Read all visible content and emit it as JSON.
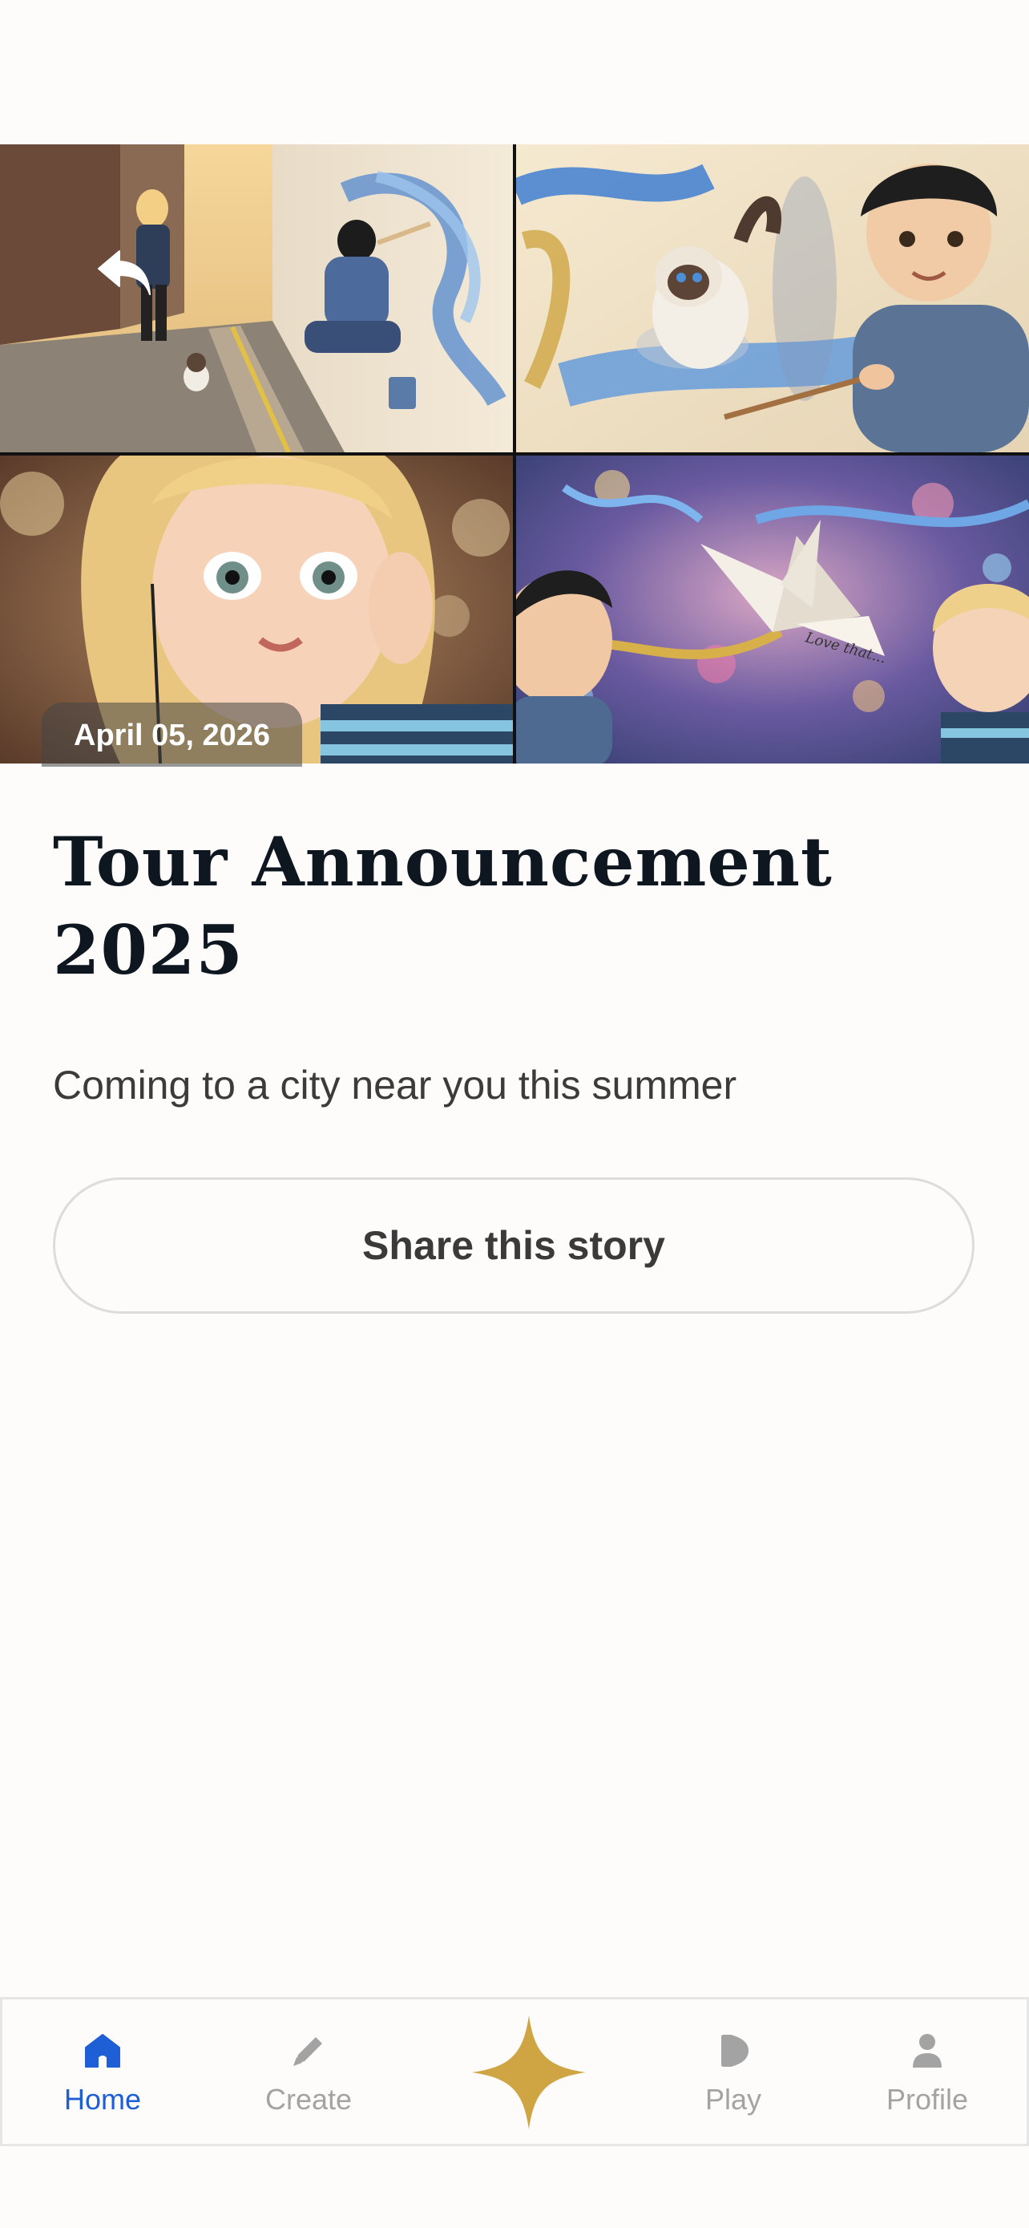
{
  "hero": {
    "date": "April 05, 2026",
    "back_icon": "back-arrow-icon",
    "tile_texts": {
      "crane_note": "Love that..."
    }
  },
  "article": {
    "title": "Tour Announcement 2025",
    "subtitle": "Coming to a city near you this summer",
    "share_label": "Share this story"
  },
  "tabbar": {
    "active_color": "#1f5fd6",
    "inactive_color": "#a3a3a3",
    "accent_color": "#cfa544",
    "items": [
      {
        "label": "Home",
        "icon": "home-icon",
        "active": true
      },
      {
        "label": "Create",
        "icon": "pencil-icon",
        "active": false
      },
      {
        "label": "",
        "icon": "sparkle-star-icon",
        "active": false
      },
      {
        "label": "Play",
        "icon": "play-icon",
        "active": false
      },
      {
        "label": "Profile",
        "icon": "person-icon",
        "active": false
      }
    ]
  }
}
